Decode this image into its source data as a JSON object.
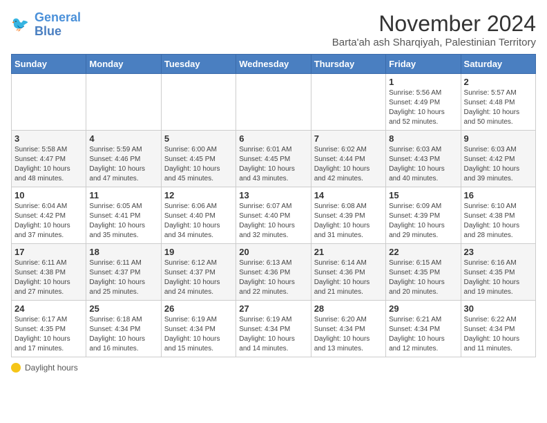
{
  "header": {
    "logo_line1": "General",
    "logo_line2": "Blue",
    "month_title": "November 2024",
    "subtitle": "Barta'ah ash Sharqiyah, Palestinian Territory"
  },
  "weekdays": [
    "Sunday",
    "Monday",
    "Tuesday",
    "Wednesday",
    "Thursday",
    "Friday",
    "Saturday"
  ],
  "weeks": [
    [
      {
        "day": "",
        "info": ""
      },
      {
        "day": "",
        "info": ""
      },
      {
        "day": "",
        "info": ""
      },
      {
        "day": "",
        "info": ""
      },
      {
        "day": "",
        "info": ""
      },
      {
        "day": "1",
        "info": "Sunrise: 5:56 AM\nSunset: 4:49 PM\nDaylight: 10 hours and 52 minutes."
      },
      {
        "day": "2",
        "info": "Sunrise: 5:57 AM\nSunset: 4:48 PM\nDaylight: 10 hours and 50 minutes."
      }
    ],
    [
      {
        "day": "3",
        "info": "Sunrise: 5:58 AM\nSunset: 4:47 PM\nDaylight: 10 hours and 48 minutes."
      },
      {
        "day": "4",
        "info": "Sunrise: 5:59 AM\nSunset: 4:46 PM\nDaylight: 10 hours and 47 minutes."
      },
      {
        "day": "5",
        "info": "Sunrise: 6:00 AM\nSunset: 4:45 PM\nDaylight: 10 hours and 45 minutes."
      },
      {
        "day": "6",
        "info": "Sunrise: 6:01 AM\nSunset: 4:45 PM\nDaylight: 10 hours and 43 minutes."
      },
      {
        "day": "7",
        "info": "Sunrise: 6:02 AM\nSunset: 4:44 PM\nDaylight: 10 hours and 42 minutes."
      },
      {
        "day": "8",
        "info": "Sunrise: 6:03 AM\nSunset: 4:43 PM\nDaylight: 10 hours and 40 minutes."
      },
      {
        "day": "9",
        "info": "Sunrise: 6:03 AM\nSunset: 4:42 PM\nDaylight: 10 hours and 39 minutes."
      }
    ],
    [
      {
        "day": "10",
        "info": "Sunrise: 6:04 AM\nSunset: 4:42 PM\nDaylight: 10 hours and 37 minutes."
      },
      {
        "day": "11",
        "info": "Sunrise: 6:05 AM\nSunset: 4:41 PM\nDaylight: 10 hours and 35 minutes."
      },
      {
        "day": "12",
        "info": "Sunrise: 6:06 AM\nSunset: 4:40 PM\nDaylight: 10 hours and 34 minutes."
      },
      {
        "day": "13",
        "info": "Sunrise: 6:07 AM\nSunset: 4:40 PM\nDaylight: 10 hours and 32 minutes."
      },
      {
        "day": "14",
        "info": "Sunrise: 6:08 AM\nSunset: 4:39 PM\nDaylight: 10 hours and 31 minutes."
      },
      {
        "day": "15",
        "info": "Sunrise: 6:09 AM\nSunset: 4:39 PM\nDaylight: 10 hours and 29 minutes."
      },
      {
        "day": "16",
        "info": "Sunrise: 6:10 AM\nSunset: 4:38 PM\nDaylight: 10 hours and 28 minutes."
      }
    ],
    [
      {
        "day": "17",
        "info": "Sunrise: 6:11 AM\nSunset: 4:38 PM\nDaylight: 10 hours and 27 minutes."
      },
      {
        "day": "18",
        "info": "Sunrise: 6:11 AM\nSunset: 4:37 PM\nDaylight: 10 hours and 25 minutes."
      },
      {
        "day": "19",
        "info": "Sunrise: 6:12 AM\nSunset: 4:37 PM\nDaylight: 10 hours and 24 minutes."
      },
      {
        "day": "20",
        "info": "Sunrise: 6:13 AM\nSunset: 4:36 PM\nDaylight: 10 hours and 22 minutes."
      },
      {
        "day": "21",
        "info": "Sunrise: 6:14 AM\nSunset: 4:36 PM\nDaylight: 10 hours and 21 minutes."
      },
      {
        "day": "22",
        "info": "Sunrise: 6:15 AM\nSunset: 4:35 PM\nDaylight: 10 hours and 20 minutes."
      },
      {
        "day": "23",
        "info": "Sunrise: 6:16 AM\nSunset: 4:35 PM\nDaylight: 10 hours and 19 minutes."
      }
    ],
    [
      {
        "day": "24",
        "info": "Sunrise: 6:17 AM\nSunset: 4:35 PM\nDaylight: 10 hours and 17 minutes."
      },
      {
        "day": "25",
        "info": "Sunrise: 6:18 AM\nSunset: 4:34 PM\nDaylight: 10 hours and 16 minutes."
      },
      {
        "day": "26",
        "info": "Sunrise: 6:19 AM\nSunset: 4:34 PM\nDaylight: 10 hours and 15 minutes."
      },
      {
        "day": "27",
        "info": "Sunrise: 6:19 AM\nSunset: 4:34 PM\nDaylight: 10 hours and 14 minutes."
      },
      {
        "day": "28",
        "info": "Sunrise: 6:20 AM\nSunset: 4:34 PM\nDaylight: 10 hours and 13 minutes."
      },
      {
        "day": "29",
        "info": "Sunrise: 6:21 AM\nSunset: 4:34 PM\nDaylight: 10 hours and 12 minutes."
      },
      {
        "day": "30",
        "info": "Sunrise: 6:22 AM\nSunset: 4:34 PM\nDaylight: 10 hours and 11 minutes."
      }
    ]
  ],
  "legend": {
    "icon_label": "sun-icon",
    "text": "Daylight hours"
  }
}
